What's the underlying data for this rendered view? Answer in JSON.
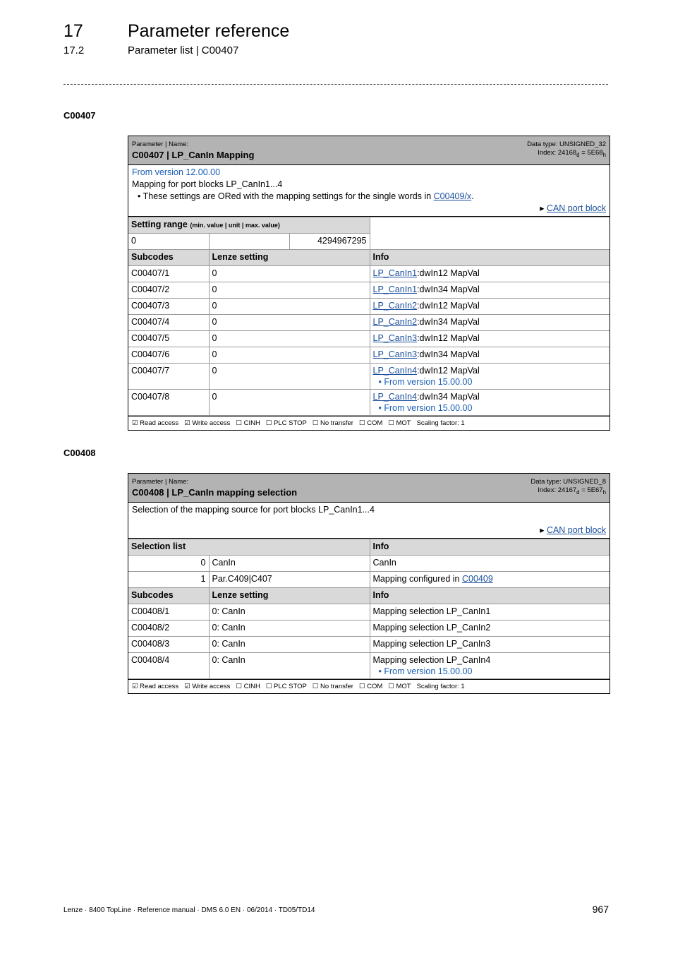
{
  "header": {
    "chapter_num": "17",
    "chapter_title": "Parameter reference",
    "section_num": "17.2",
    "section_title": "Parameter list | C00407"
  },
  "params": [
    {
      "heading": "C00407",
      "label": "Parameter | Name:",
      "name": "C00407 | LP_CanIn Mapping",
      "data_type": "Data type: UNSIGNED_32",
      "index_d": "24168",
      "index_h": "5E68",
      "version": "From version 12.00.00",
      "desc": "Mapping for port blocks LP_CanIn1...4",
      "bullet_pre": "These settings are ORed with the mapping settings for the single words in ",
      "bullet_link": "C00409/x",
      "bullet_post": ".",
      "port_link": "CAN port block",
      "range": {
        "title": "Setting range",
        "sub": "(min. value | unit | max. value)",
        "min": "0",
        "unit": "",
        "max": "4294967295"
      },
      "cols": [
        "Subcodes",
        "Lenze setting",
        "Info"
      ],
      "rows": [
        {
          "sub": "C00407/1",
          "val": "0",
          "link": "LP_CanIn1",
          "info": ":dwIn12 MapVal"
        },
        {
          "sub": "C00407/2",
          "val": "0",
          "link": "LP_CanIn1",
          "info": ":dwIn34 MapVal"
        },
        {
          "sub": "C00407/3",
          "val": "0",
          "link": "LP_CanIn2",
          "info": ":dwIn12 MapVal"
        },
        {
          "sub": "C00407/4",
          "val": "0",
          "link": "LP_CanIn2",
          "info": ":dwIn34 MapVal"
        },
        {
          "sub": "C00407/5",
          "val": "0",
          "link": "LP_CanIn3",
          "info": ":dwIn12 MapVal"
        },
        {
          "sub": "C00407/6",
          "val": "0",
          "link": "LP_CanIn3",
          "info": ":dwIn34 MapVal"
        },
        {
          "sub": "C00407/7",
          "val": "0",
          "link": "LP_CanIn4",
          "info": ":dwIn12 MapVal",
          "note": "From version 15.00.00"
        },
        {
          "sub": "C00407/8",
          "val": "0",
          "link": "LP_CanIn4",
          "info": ":dwIn34 MapVal",
          "note": "From version 15.00.00"
        }
      ],
      "footer": [
        "☑ Read access",
        "☑ Write access",
        "☐ CINH",
        "☐ PLC STOP",
        "☐ No transfer",
        "☐ COM",
        "☐ MOT",
        "Scaling factor: 1"
      ]
    },
    {
      "heading": "C00408",
      "label": "Parameter | Name:",
      "name": "C00408 | LP_CanIn mapping selection",
      "data_type": "Data type: UNSIGNED_8",
      "index_d": "24167",
      "index_h": "5E67",
      "desc": "Selection of the mapping source for port blocks LP_CanIn1...4",
      "port_link": "CAN port block",
      "sel_cols": [
        "Selection list",
        "Info"
      ],
      "sel": [
        {
          "n": "0",
          "label": "CanIn",
          "info": "CanIn"
        },
        {
          "n": "1",
          "label": "Par.C409|C407",
          "info": "Mapping configured in ",
          "link": "C00409"
        }
      ],
      "cols": [
        "Subcodes",
        "Lenze setting",
        "Info"
      ],
      "rows": [
        {
          "sub": "C00408/1",
          "val": "0: CanIn",
          "info": "Mapping selection LP_CanIn1"
        },
        {
          "sub": "C00408/2",
          "val": "0: CanIn",
          "info": "Mapping selection LP_CanIn2"
        },
        {
          "sub": "C00408/3",
          "val": "0: CanIn",
          "info": "Mapping selection LP_CanIn3"
        },
        {
          "sub": "C00408/4",
          "val": "0: CanIn",
          "info": "Mapping selection LP_CanIn4",
          "note": "From version 15.00.00"
        }
      ],
      "footer": [
        "☑ Read access",
        "☑ Write access",
        "☐ CINH",
        "☐ PLC STOP",
        "☐ No transfer",
        "☐ COM",
        "☐ MOT",
        "Scaling factor: 1"
      ]
    }
  ],
  "page_footer": "Lenze · 8400 TopLine · Reference manual · DMS 6.0 EN · 06/2014 · TD05/TD14",
  "page_number": "967"
}
